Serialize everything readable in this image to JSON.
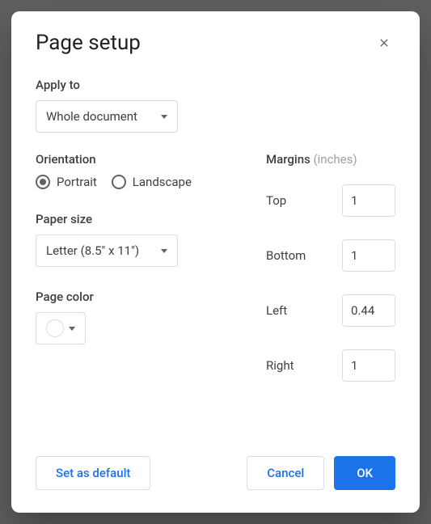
{
  "dialog": {
    "title": "Page setup"
  },
  "applyTo": {
    "label": "Apply to",
    "selected": "Whole document"
  },
  "orientation": {
    "label": "Orientation",
    "options": [
      "Portrait",
      "Landscape"
    ],
    "selected": "Portrait"
  },
  "paperSize": {
    "label": "Paper size",
    "selected": "Letter (8.5\" x 11\")"
  },
  "pageColor": {
    "label": "Page color",
    "value": "#ffffff"
  },
  "margins": {
    "label": "Margins",
    "unit": "(inches)",
    "top": {
      "label": "Top",
      "value": "1"
    },
    "bottom": {
      "label": "Bottom",
      "value": "1"
    },
    "left": {
      "label": "Left",
      "value": "0.44"
    },
    "right": {
      "label": "Right",
      "value": "1"
    }
  },
  "buttons": {
    "setDefault": "Set as default",
    "cancel": "Cancel",
    "ok": "OK"
  }
}
